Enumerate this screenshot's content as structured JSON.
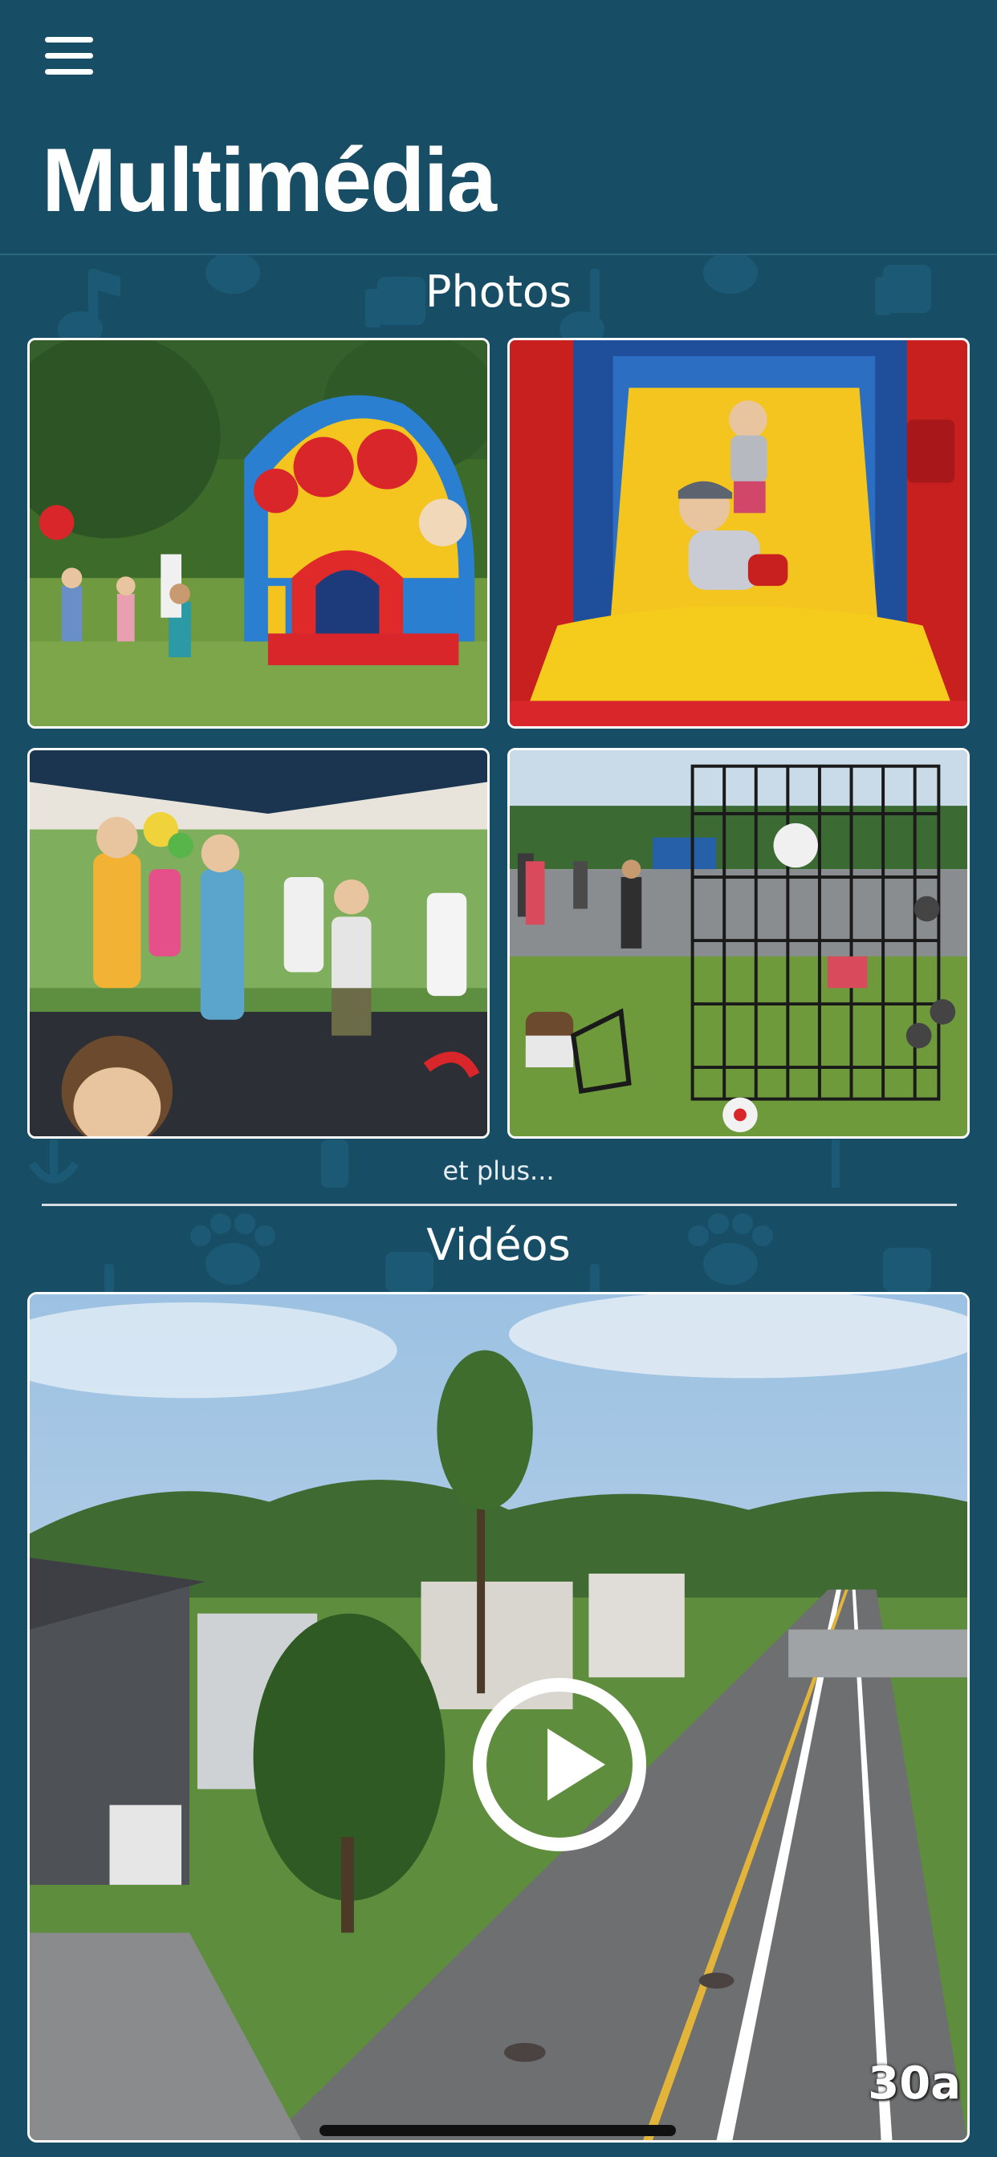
{
  "header": {
    "title": "Multimédia",
    "menu_icon": "hamburger-menu-icon"
  },
  "photos": {
    "heading": "Photos",
    "items": [
      {
        "alt": "bouncy-castle-party"
      },
      {
        "alt": "inflatable-slide-kids"
      },
      {
        "alt": "kids-dancing-tent"
      },
      {
        "alt": "dunk-tank-street-fair"
      }
    ],
    "more_label": "et plus..."
  },
  "videos": {
    "heading": "Vidéos",
    "timestamp": "30a",
    "play_icon": "play-icon"
  },
  "colors": {
    "background": "#174e66",
    "text": "#ffffff"
  }
}
